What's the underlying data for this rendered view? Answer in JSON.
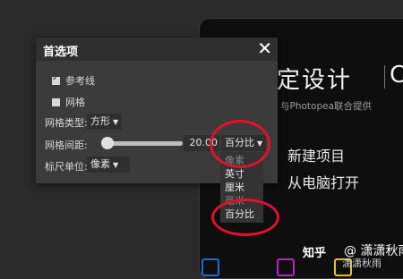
{
  "background_app": {
    "title": "定设计",
    "title_extra": "C",
    "subtitle": "与Photopea联合提供",
    "actions": [
      "新建项目",
      "从电脑打开"
    ]
  },
  "watermark": {
    "logo": "知乎",
    "author": "@ 潇潇秋雨",
    "overlay_text": "潇潇秋雨"
  },
  "dialog": {
    "title": "首选项",
    "close_icon": "close-icon",
    "guides_label": "参考线",
    "guides_checked": true,
    "grid_label": "网格",
    "grid_checked": false,
    "grid_type_label": "网格类型:",
    "grid_type_value": "方形",
    "grid_spacing_label": "网格间距:",
    "grid_spacing_value": "20.00",
    "grid_spacing_unit": "百分比",
    "ruler_unit_label": "标尺单位:",
    "ruler_unit_value": "像素",
    "unit_options": [
      "像素",
      "英寸",
      "厘米",
      "毫米",
      "百分比"
    ]
  },
  "colors": {
    "dialog_bg": "#3b3b3b",
    "annotation": "#e0112b"
  }
}
